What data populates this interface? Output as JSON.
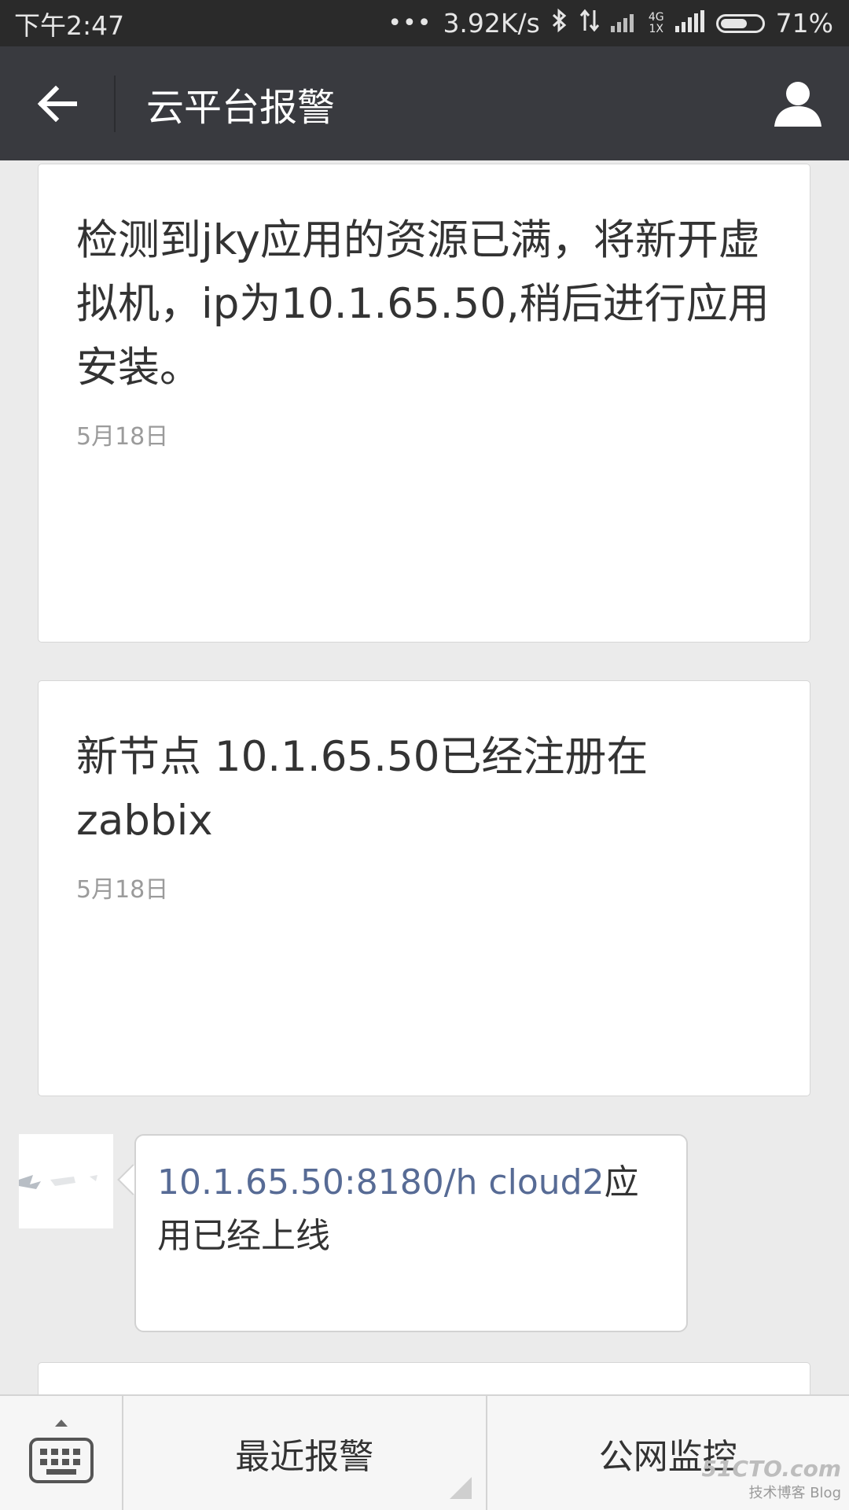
{
  "status_bar": {
    "time": "下午2:47",
    "dots": "•••",
    "net_speed": "3.92K/s",
    "bluetooth_icon": "bluetooth-icon",
    "data_icon": "data-transfer-icon",
    "network_label_top": "4G",
    "network_label_bottom": "1X",
    "battery_level": 0.71,
    "battery_percent": "71%"
  },
  "header": {
    "title": "云平台报警",
    "back_icon": "back-arrow-icon",
    "profile_icon": "profile-icon"
  },
  "messages": [
    {
      "text": "检测到jky应用的资源已满，将新开虚拟机，ip为10.1.65.50,稍后进行应用安装。",
      "date": "5月18日"
    },
    {
      "text": "新节点 10.1.65.50已经注册在zabbix",
      "date": "5月18日"
    }
  ],
  "chat": {
    "link_text": "10.1.65.50:8180/h   cloud2",
    "rest_text": "应用已经上线"
  },
  "bottom_menu": {
    "keyboard_icon": "keyboard-icon",
    "items": [
      "最近报警",
      "公网监控"
    ]
  },
  "watermark": {
    "main": "51CTO.com",
    "sub": "技术博客 Blog"
  },
  "colors": {
    "title_bar": "#393a3f",
    "status_bar": "#2a2a2a",
    "link": "#576b95",
    "background": "#ebebeb"
  }
}
